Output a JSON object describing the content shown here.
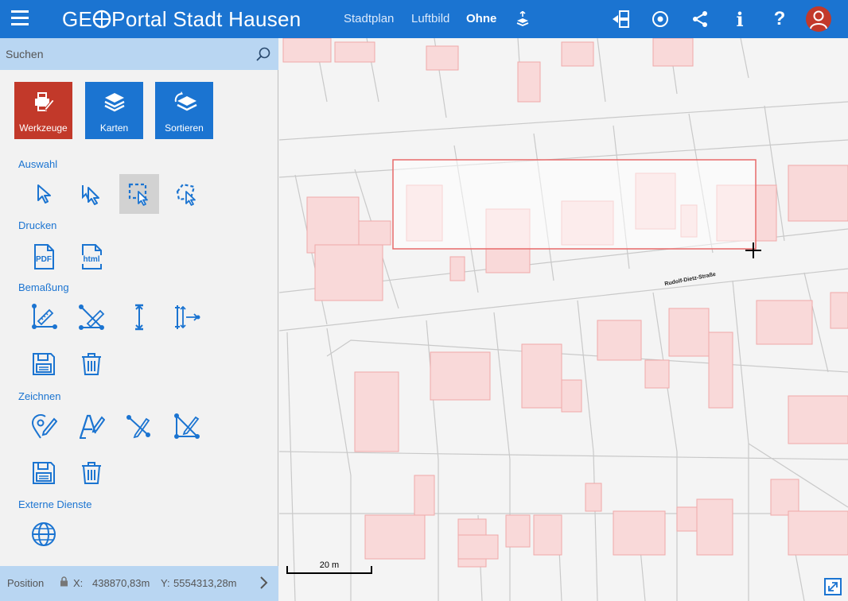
{
  "header": {
    "brand_prefix": "GE",
    "brand_suffix": "Portal Stadt Hausen",
    "nav": [
      {
        "label": "Stadtplan",
        "active": false
      },
      {
        "label": "Luftbild",
        "active": false
      },
      {
        "label": "Ohne",
        "active": true
      }
    ],
    "icons": [
      "layers-stack-icon",
      "layout-toggle-icon",
      "location-target-icon",
      "share-icon",
      "info-icon",
      "help-icon",
      "user-avatar-icon"
    ],
    "info_label": "i",
    "help_label": "?"
  },
  "sidebar": {
    "search": {
      "placeholder": "Suchen",
      "value": ""
    },
    "main_buttons": [
      {
        "label": "Werkzeuge",
        "color": "#c2392a",
        "icon": "tools-icon"
      },
      {
        "label": "Karten",
        "color": "#1b74d1",
        "icon": "layers-icon"
      },
      {
        "label": "Sortieren",
        "color": "#1b74d1",
        "icon": "sort-layers-icon"
      }
    ],
    "sections": {
      "auswahl": "Auswahl",
      "drucken": "Drucken",
      "bemassung": "Bemaßung",
      "zeichnen": "Zeichnen",
      "externe": "Externe Dienste"
    },
    "print_labels": {
      "pdf": "PDF",
      "html": "html"
    },
    "position": {
      "label": "Position",
      "x_label": "X:",
      "x": "438870,83m",
      "y_label": "Y:",
      "y": "5554313,28m"
    }
  },
  "map": {
    "street_name": "Rudolf-Dietz-Straße",
    "scale_label": "20 m",
    "building_color": "#f9d9d9",
    "building_stroke": "#f0a9a9",
    "selection_color": "#e86a6a"
  },
  "colors": {
    "primary": "#1b74d1",
    "accent": "#c2392a",
    "panel": "#b9d6f2"
  }
}
